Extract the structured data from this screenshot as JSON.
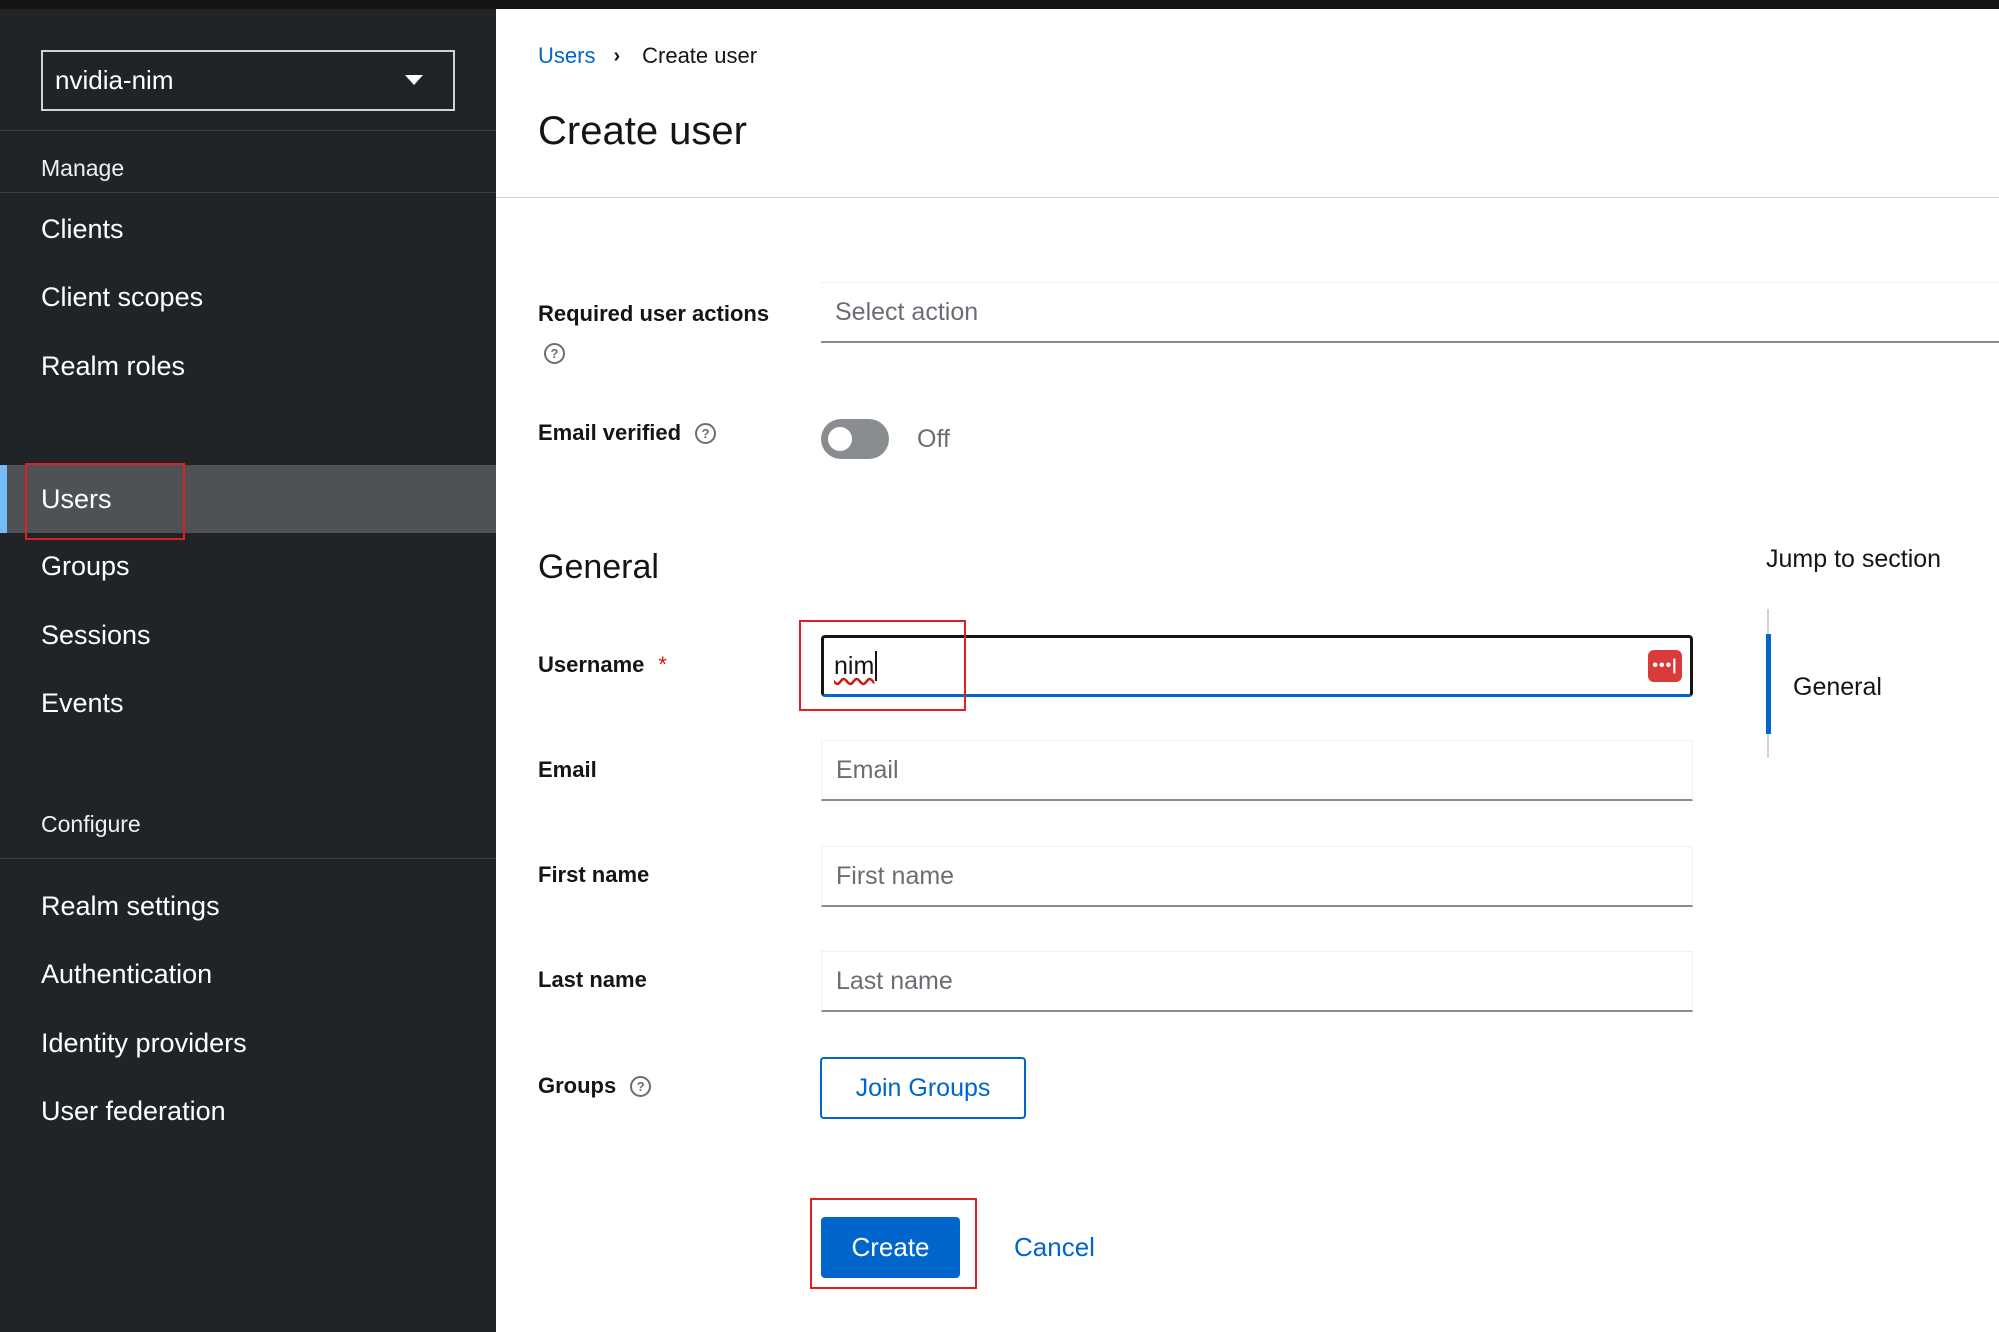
{
  "sidebar": {
    "realm": "nvidia-nim",
    "manage_label": "Manage",
    "manage_items": [
      "Clients",
      "Client scopes",
      "Realm roles",
      "Users",
      "Groups",
      "Sessions",
      "Events"
    ],
    "configure_label": "Configure",
    "configure_items": [
      "Realm settings",
      "Authentication",
      "Identity providers",
      "User federation"
    ],
    "active_item": "Users"
  },
  "breadcrumb": {
    "parent": "Users",
    "current": "Create user"
  },
  "page": {
    "title": "Create user"
  },
  "form": {
    "required_actions_label": "Required user actions",
    "required_actions_placeholder": "Select action",
    "email_verified_label": "Email verified",
    "email_verified_state": "Off",
    "section_general": "General",
    "username_label": "Username",
    "username_required": "*",
    "username_value": "nim",
    "email_label": "Email",
    "email_placeholder": "Email",
    "first_name_label": "First name",
    "first_name_placeholder": "First name",
    "last_name_label": "Last name",
    "last_name_placeholder": "Last name",
    "groups_label": "Groups",
    "join_groups_label": "Join Groups",
    "create_label": "Create",
    "cancel_label": "Cancel",
    "password_manager_icon": "password-manager-icon",
    "password_manager_glyph": "•••|"
  },
  "jump": {
    "title": "Jump to section",
    "items": [
      "General"
    ]
  },
  "colors": {
    "sidebar_bg": "#212427",
    "active_nav_bg": "#4f5255",
    "active_nav_accent": "#73bcf7",
    "primary": "#0066cc",
    "highlight": "#e02020"
  }
}
